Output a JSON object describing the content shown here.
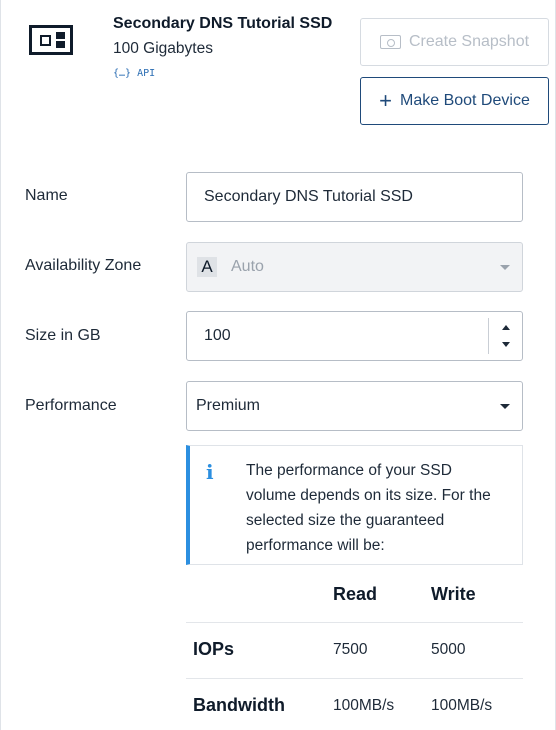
{
  "volume": {
    "name": "Secondary DNS Tutorial SSD",
    "size": "100 Gigabytes",
    "api_label": "{…} API"
  },
  "actions": {
    "create_snapshot": "Create Snapshot",
    "make_boot_device": "Make Boot Device"
  },
  "form": {
    "name_label": "Name",
    "name_value": "Secondary DNS Tutorial SSD",
    "az_label": "Availability Zone",
    "az_badge": "A",
    "az_value": "Auto",
    "size_label": "Size in GB",
    "size_value": "100",
    "performance_label": "Performance",
    "performance_value": "Premium"
  },
  "info": {
    "icon": "i",
    "text": "The performance of your SSD volume depends on its size. For the selected size the guaranteed performance will be:"
  },
  "perf_table": {
    "headers": [
      "Read",
      "Write"
    ],
    "rows": [
      {
        "label": "IOPs",
        "read": "7500",
        "write": "5000"
      },
      {
        "label": "Bandwidth",
        "read": "100MB/s",
        "write": "100MB/s"
      }
    ]
  },
  "colors": {
    "accent": "#2c8fe0",
    "primary_button": "#1f4a7a",
    "link": "#2a6db3"
  }
}
